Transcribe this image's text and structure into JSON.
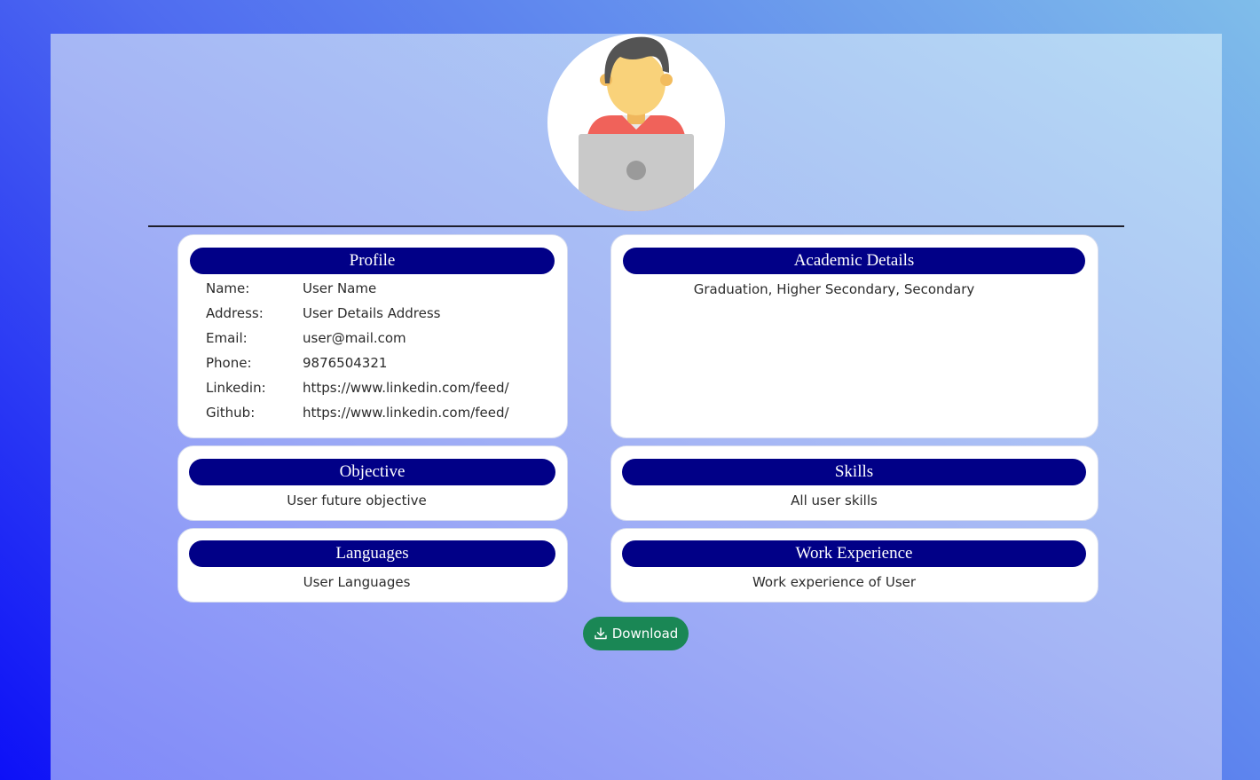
{
  "avatar": {
    "icon": "user-with-laptop-icon"
  },
  "profile": {
    "title": "Profile",
    "rows": [
      {
        "label": "Name:",
        "value": "User Name"
      },
      {
        "label": "Address:",
        "value": "User Details Address"
      },
      {
        "label": "Email:",
        "value": "user@mail.com"
      },
      {
        "label": "Phone:",
        "value": "9876504321"
      },
      {
        "label": "Linkedin:",
        "value": "https://www.linkedin.com/feed/"
      },
      {
        "label": "Github:",
        "value": "https://www.linkedin.com/feed/"
      }
    ]
  },
  "academic": {
    "title": "Academic Details",
    "text": "Graduation, Higher Secondary, Secondary"
  },
  "objective": {
    "title": "Objective",
    "text": "User future objective"
  },
  "skills": {
    "title": "Skills",
    "text": "All user skills"
  },
  "languages": {
    "title": "Languages",
    "text": "User Languages"
  },
  "experience": {
    "title": "Work Experience",
    "text": "Work experience of User"
  },
  "download": {
    "label": "Download",
    "icon": "download-icon"
  },
  "colors": {
    "header_bar": "#010087",
    "download_button": "#1a8755",
    "card_background": "#ffffff"
  }
}
